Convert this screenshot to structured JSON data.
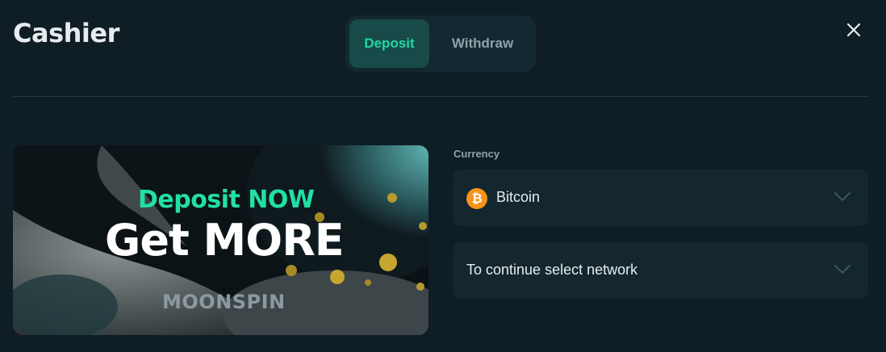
{
  "header": {
    "title": "Cashier",
    "tabs": [
      {
        "label": "Deposit",
        "active": true
      },
      {
        "label": "Withdraw",
        "active": false
      }
    ],
    "close_icon": "close-icon"
  },
  "banner": {
    "headline": "Deposit NOW",
    "subheadline": "Get MORE",
    "brand": "MOONSPIN"
  },
  "form": {
    "currency_label": "Currency",
    "currency_value": "Bitcoin",
    "currency_icon": "bitcoin-icon",
    "currency_symbol": "₿",
    "network_placeholder": "To continue select network"
  },
  "colors": {
    "background": "#0f1d24",
    "accent": "#25d6a2",
    "bitcoin": "#f7931a"
  }
}
